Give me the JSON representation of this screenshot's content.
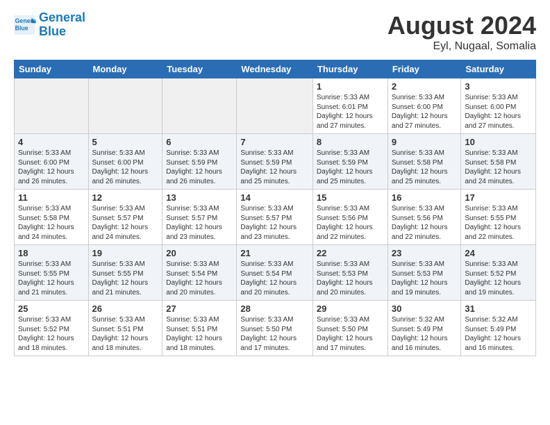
{
  "header": {
    "logo_line1": "General",
    "logo_line2": "Blue",
    "title": "August 2024",
    "subtitle": "Eyl, Nugaal, Somalia"
  },
  "weekdays": [
    "Sunday",
    "Monday",
    "Tuesday",
    "Wednesday",
    "Thursday",
    "Friday",
    "Saturday"
  ],
  "weeks": [
    [
      {
        "day": "",
        "info": ""
      },
      {
        "day": "",
        "info": ""
      },
      {
        "day": "",
        "info": ""
      },
      {
        "day": "",
        "info": ""
      },
      {
        "day": "1",
        "info": "Sunrise: 5:33 AM\nSunset: 6:01 PM\nDaylight: 12 hours\nand 27 minutes."
      },
      {
        "day": "2",
        "info": "Sunrise: 5:33 AM\nSunset: 6:00 PM\nDaylight: 12 hours\nand 27 minutes."
      },
      {
        "day": "3",
        "info": "Sunrise: 5:33 AM\nSunset: 6:00 PM\nDaylight: 12 hours\nand 27 minutes."
      }
    ],
    [
      {
        "day": "4",
        "info": "Sunrise: 5:33 AM\nSunset: 6:00 PM\nDaylight: 12 hours\nand 26 minutes."
      },
      {
        "day": "5",
        "info": "Sunrise: 5:33 AM\nSunset: 6:00 PM\nDaylight: 12 hours\nand 26 minutes."
      },
      {
        "day": "6",
        "info": "Sunrise: 5:33 AM\nSunset: 5:59 PM\nDaylight: 12 hours\nand 26 minutes."
      },
      {
        "day": "7",
        "info": "Sunrise: 5:33 AM\nSunset: 5:59 PM\nDaylight: 12 hours\nand 25 minutes."
      },
      {
        "day": "8",
        "info": "Sunrise: 5:33 AM\nSunset: 5:59 PM\nDaylight: 12 hours\nand 25 minutes."
      },
      {
        "day": "9",
        "info": "Sunrise: 5:33 AM\nSunset: 5:58 PM\nDaylight: 12 hours\nand 25 minutes."
      },
      {
        "day": "10",
        "info": "Sunrise: 5:33 AM\nSunset: 5:58 PM\nDaylight: 12 hours\nand 24 minutes."
      }
    ],
    [
      {
        "day": "11",
        "info": "Sunrise: 5:33 AM\nSunset: 5:58 PM\nDaylight: 12 hours\nand 24 minutes."
      },
      {
        "day": "12",
        "info": "Sunrise: 5:33 AM\nSunset: 5:57 PM\nDaylight: 12 hours\nand 24 minutes."
      },
      {
        "day": "13",
        "info": "Sunrise: 5:33 AM\nSunset: 5:57 PM\nDaylight: 12 hours\nand 23 minutes."
      },
      {
        "day": "14",
        "info": "Sunrise: 5:33 AM\nSunset: 5:57 PM\nDaylight: 12 hours\nand 23 minutes."
      },
      {
        "day": "15",
        "info": "Sunrise: 5:33 AM\nSunset: 5:56 PM\nDaylight: 12 hours\nand 22 minutes."
      },
      {
        "day": "16",
        "info": "Sunrise: 5:33 AM\nSunset: 5:56 PM\nDaylight: 12 hours\nand 22 minutes."
      },
      {
        "day": "17",
        "info": "Sunrise: 5:33 AM\nSunset: 5:55 PM\nDaylight: 12 hours\nand 22 minutes."
      }
    ],
    [
      {
        "day": "18",
        "info": "Sunrise: 5:33 AM\nSunset: 5:55 PM\nDaylight: 12 hours\nand 21 minutes."
      },
      {
        "day": "19",
        "info": "Sunrise: 5:33 AM\nSunset: 5:55 PM\nDaylight: 12 hours\nand 21 minutes."
      },
      {
        "day": "20",
        "info": "Sunrise: 5:33 AM\nSunset: 5:54 PM\nDaylight: 12 hours\nand 20 minutes."
      },
      {
        "day": "21",
        "info": "Sunrise: 5:33 AM\nSunset: 5:54 PM\nDaylight: 12 hours\nand 20 minutes."
      },
      {
        "day": "22",
        "info": "Sunrise: 5:33 AM\nSunset: 5:53 PM\nDaylight: 12 hours\nand 20 minutes."
      },
      {
        "day": "23",
        "info": "Sunrise: 5:33 AM\nSunset: 5:53 PM\nDaylight: 12 hours\nand 19 minutes."
      },
      {
        "day": "24",
        "info": "Sunrise: 5:33 AM\nSunset: 5:52 PM\nDaylight: 12 hours\nand 19 minutes."
      }
    ],
    [
      {
        "day": "25",
        "info": "Sunrise: 5:33 AM\nSunset: 5:52 PM\nDaylight: 12 hours\nand 18 minutes."
      },
      {
        "day": "26",
        "info": "Sunrise: 5:33 AM\nSunset: 5:51 PM\nDaylight: 12 hours\nand 18 minutes."
      },
      {
        "day": "27",
        "info": "Sunrise: 5:33 AM\nSunset: 5:51 PM\nDaylight: 12 hours\nand 18 minutes."
      },
      {
        "day": "28",
        "info": "Sunrise: 5:33 AM\nSunset: 5:50 PM\nDaylight: 12 hours\nand 17 minutes."
      },
      {
        "day": "29",
        "info": "Sunrise: 5:33 AM\nSunset: 5:50 PM\nDaylight: 12 hours\nand 17 minutes."
      },
      {
        "day": "30",
        "info": "Sunrise: 5:32 AM\nSunset: 5:49 PM\nDaylight: 12 hours\nand 16 minutes."
      },
      {
        "day": "31",
        "info": "Sunrise: 5:32 AM\nSunset: 5:49 PM\nDaylight: 12 hours\nand 16 minutes."
      }
    ]
  ]
}
